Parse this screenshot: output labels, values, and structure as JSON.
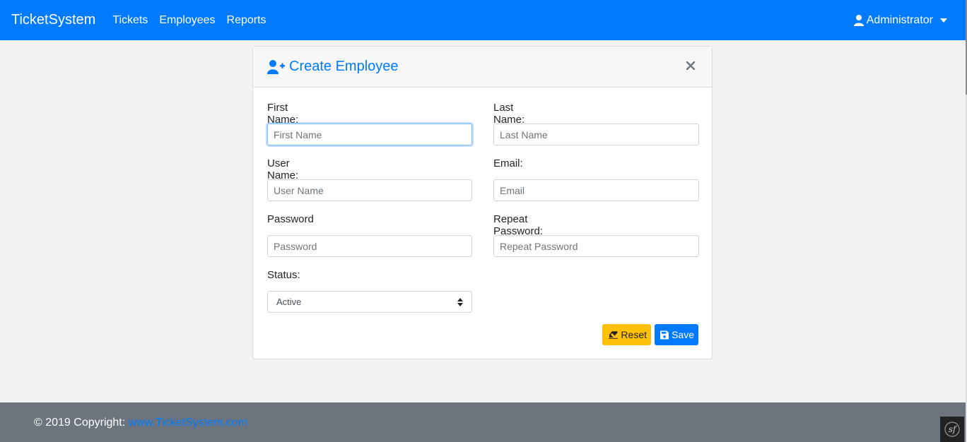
{
  "navbar": {
    "brand": "TicketSystem",
    "links": [
      "Tickets",
      "Employees",
      "Reports"
    ],
    "user": "Administrator"
  },
  "card": {
    "title": "Create Employee",
    "fields": {
      "first_name": {
        "label": "First Name:",
        "placeholder": "First Name"
      },
      "last_name": {
        "label": "Last Name:",
        "placeholder": "Last Name"
      },
      "user_name": {
        "label": "User Name:",
        "placeholder": "User Name"
      },
      "email": {
        "label": "Email:",
        "placeholder": "Email"
      },
      "password": {
        "label": "Password",
        "placeholder": "Password"
      },
      "repeat_password": {
        "label": "Repeat Password:",
        "placeholder": "Repeat Password"
      },
      "status": {
        "label": "Status:",
        "value": "Active"
      }
    },
    "buttons": {
      "reset": "Reset",
      "save": "Save"
    }
  },
  "footer": {
    "copyright": "© 2019 Copyright: ",
    "link": "www.TicketSystem.com"
  },
  "icons": {
    "user": "user-icon",
    "user_plus": "user-plus-icon",
    "close": "close-icon",
    "eraser": "eraser-icon",
    "save": "save-icon",
    "symfony": "symfony-icon"
  },
  "colors": {
    "primary": "#007bff",
    "warning": "#ffc107",
    "footer": "#6c757d"
  }
}
